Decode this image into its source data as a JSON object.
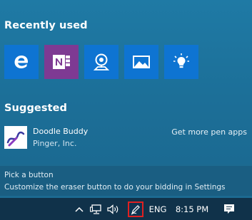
{
  "recently_used": {
    "title": "Recently used",
    "apps": [
      {
        "name": "edge-icon",
        "color": "#0e74d2"
      },
      {
        "name": "onenote-icon",
        "color": "#7e3a93"
      },
      {
        "name": "maps-icon",
        "color": "#0e74d2"
      },
      {
        "name": "photos-icon",
        "color": "#0e74d2"
      },
      {
        "name": "tips-icon",
        "color": "#0e74d2"
      }
    ]
  },
  "suggested": {
    "title": "Suggested",
    "app": {
      "name": "Doodle Buddy",
      "publisher": "Pinger, Inc."
    },
    "more_link": "Get more pen apps"
  },
  "hint": {
    "title": "Pick a button",
    "text": "Customize the eraser button to do your bidding in Settings"
  },
  "taskbar": {
    "language": "ENG",
    "time": "8:15 PM",
    "highlight_color": "#e02020"
  }
}
